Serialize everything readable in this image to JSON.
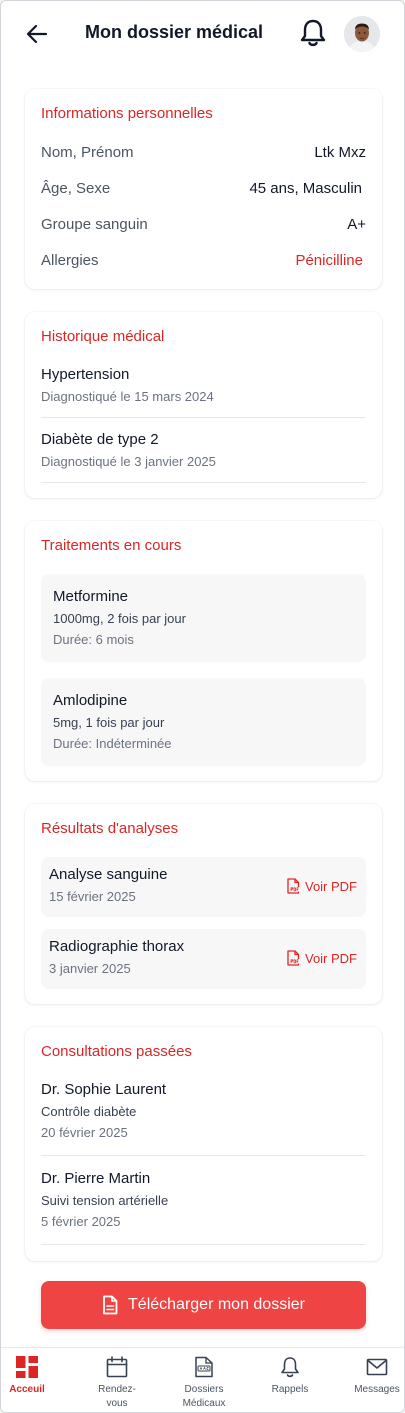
{
  "header": {
    "title": "Mon dossier médical"
  },
  "personal": {
    "title": "Informations personnelles",
    "rows": [
      {
        "label": "Nom, Prénom",
        "value": "Ltk Mxz"
      },
      {
        "label": "Âge, Sexe",
        "value": "45 ans, Masculin"
      },
      {
        "label": "Groupe sanguin",
        "value": "A+"
      },
      {
        "label": "Allergies",
        "value": "Pénicilline"
      }
    ]
  },
  "history": {
    "title": "Historique médical",
    "items": [
      {
        "name": "Hypertension",
        "date": "Diagnostiqué le 15 mars 2024"
      },
      {
        "name": "Diabète de type 2",
        "date": "Diagnostiqué le 3 janvier 2025"
      }
    ]
  },
  "treatments": {
    "title": "Traitements en cours",
    "items": [
      {
        "name": "Metformine",
        "dose": "1000mg, 2 fois par jour",
        "duration": "Durée: 6 mois"
      },
      {
        "name": "Amlodipine",
        "dose": "5mg, 1 fois par jour",
        "duration": "Durée: Indéterminée"
      }
    ]
  },
  "results": {
    "title": "Résultats d'analyses",
    "link_label": "Voir PDF",
    "items": [
      {
        "name": "Analyse sanguine",
        "date": "15 février 2025"
      },
      {
        "name": "Radiographie thorax",
        "date": "3 janvier 2025"
      }
    ]
  },
  "consultations": {
    "title": "Consultations passées",
    "items": [
      {
        "doctor": "Dr. Sophie Laurent",
        "reason": "Contrôle diabète",
        "date": "20 février 2025"
      },
      {
        "doctor": "Dr. Pierre Martin",
        "reason": "Suivi tension artérielle",
        "date": "5 février 2025"
      }
    ]
  },
  "download": {
    "label": "Télécharger mon dossier"
  },
  "nav": {
    "items": [
      {
        "label": "Acceuil",
        "icon": "home-grid-icon",
        "active": true
      },
      {
        "label": "Rendez-\nvous",
        "icon": "calendar-icon",
        "active": false
      },
      {
        "label": "Dossiers\nMédicaux",
        "icon": "medical-file-icon",
        "active": false
      },
      {
        "label": "Rappels",
        "icon": "bell-icon",
        "active": false
      },
      {
        "label": "Messages",
        "icon": "mail-icon",
        "active": false
      }
    ]
  },
  "colors": {
    "accent": "#dc2626",
    "button": "#ef4444",
    "text": "#111827",
    "muted": "#6b7280"
  }
}
